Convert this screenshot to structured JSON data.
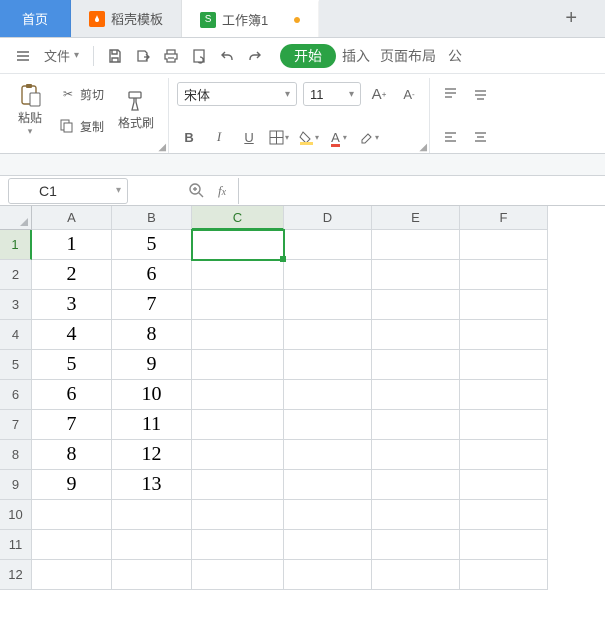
{
  "tabs": {
    "home": "首页",
    "docer": "稻壳模板",
    "workbook": "工作簿1"
  },
  "qat": {
    "file": "文件",
    "menu_insert": "插入",
    "menu_layout": "页面布局",
    "menu_formula_partial": "公",
    "start": "开始"
  },
  "clipboard": {
    "paste": "粘贴",
    "cut": "剪切",
    "copy": "复制",
    "format_painter": "格式刷"
  },
  "font": {
    "name": "宋体",
    "size": "11"
  },
  "namebox": "C1",
  "formula": "",
  "columns": [
    "A",
    "B",
    "C",
    "D",
    "E",
    "F"
  ],
  "rows": [
    {
      "n": "1",
      "A": "1",
      "B": "5"
    },
    {
      "n": "2",
      "A": "2",
      "B": "6"
    },
    {
      "n": "3",
      "A": "3",
      "B": "7"
    },
    {
      "n": "4",
      "A": "4",
      "B": "8"
    },
    {
      "n": "5",
      "A": "5",
      "B": "9"
    },
    {
      "n": "6",
      "A": "6",
      "B": "10"
    },
    {
      "n": "7",
      "A": "7",
      "B": "11"
    },
    {
      "n": "8",
      "A": "8",
      "B": "12"
    },
    {
      "n": "9",
      "A": "9",
      "B": "13"
    },
    {
      "n": "10",
      "A": "",
      "B": ""
    },
    {
      "n": "11",
      "A": "",
      "B": ""
    },
    {
      "n": "12",
      "A": "",
      "B": ""
    }
  ],
  "selected": {
    "row": 0,
    "col": "C"
  }
}
